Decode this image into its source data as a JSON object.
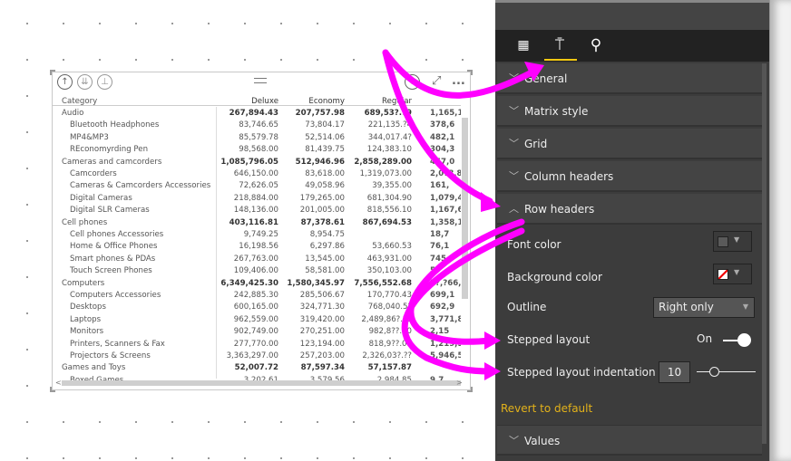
{
  "visual": {
    "toolbar": {
      "drill_up": "arrow-up-icon",
      "drill_down_all": "double-arrow-down-icon",
      "expand": "expand-hierarchy-icon",
      "drill_mode": "arrow-down-circle-icon",
      "focus": "focus-mode-icon",
      "more": "..."
    },
    "columns": [
      "Category",
      "Deluxe",
      "Economy",
      "Regular",
      ""
    ],
    "rows": [
      {
        "level": 0,
        "cat": "Audio",
        "v": [
          "267,894.43",
          "207,757.98",
          "689,53?.?9",
          "1,165,1"
        ]
      },
      {
        "level": 1,
        "cat": "Bluetooth Headphones",
        "v": [
          "83,746.65",
          "73,804.17",
          "221,135.?4",
          "378,6"
        ]
      },
      {
        "level": 1,
        "cat": "MP4&MP3",
        "v": [
          "85,579.78",
          "52,514.06",
          "344,017.4?",
          "482,1"
        ]
      },
      {
        "level": 1,
        "cat": "REconomyrding Pen",
        "v": [
          "98,568.00",
          "81,439.75",
          "124,383.10",
          "304,3"
        ]
      },
      {
        "level": 0,
        "cat": "Cameras and camcorders",
        "v": [
          "1,085,796.05",
          "512,946.96",
          "2,858,289.00",
          "457,0"
        ]
      },
      {
        "level": 1,
        "cat": "Camcorders",
        "v": [
          "646,150.00",
          "83,618.00",
          "1,319,073.00",
          "2,0?8,8"
        ]
      },
      {
        "level": 1,
        "cat": "Cameras & Camcorders Accessories",
        "v": [
          "72,626.05",
          "49,058.96",
          "39,355.00",
          "161,"
        ]
      },
      {
        "level": 1,
        "cat": "Digital Cameras",
        "v": [
          "218,884.00",
          "179,265.00",
          "681,304.90",
          "1,079,4"
        ]
      },
      {
        "level": 1,
        "cat": "Digital SLR Cameras",
        "v": [
          "148,136.00",
          "201,005.00",
          "818,556.10",
          "1,167,6"
        ]
      },
      {
        "level": 0,
        "cat": "Cell phones",
        "v": [
          "403,116.81",
          "87,378.61",
          "867,694.53",
          "1,358,1"
        ]
      },
      {
        "level": 1,
        "cat": "Cell phones Accessories",
        "v": [
          "9,749.25",
          "8,954.75",
          "",
          "18,7"
        ]
      },
      {
        "level": 1,
        "cat": "Home & Office Phones",
        "v": [
          "16,198.56",
          "6,297.86",
          "53,660.53",
          "76,1"
        ]
      },
      {
        "level": 1,
        "cat": "Smart phones & PDAs",
        "v": [
          "267,763.00",
          "13,545.00",
          "463,931.00",
          "745,"
        ]
      },
      {
        "level": 1,
        "cat": "Touch Screen Phones",
        "v": [
          "109,406.00",
          "58,581.00",
          "350,103.00",
          "5"
        ]
      },
      {
        "level": 0,
        "cat": "Computers",
        "v": [
          "6,349,425.30",
          "1,580,345.97",
          "7,556,552.68",
          "1?,?66,3"
        ]
      },
      {
        "level": 1,
        "cat": "Computers Accessories",
        "v": [
          "242,885.30",
          "285,506.67",
          "170,770.43",
          "699,1"
        ]
      },
      {
        "level": 1,
        "cat": "Desktops",
        "v": [
          "600,165.00",
          "324,771.30",
          "768,040.5?",
          "692,9"
        ]
      },
      {
        "level": 1,
        "cat": "Laptops",
        "v": [
          "962,559.00",
          "319,420.00",
          "2,489,86?.?5",
          "3,771,8"
        ]
      },
      {
        "level": 1,
        "cat": "Monitors",
        "v": [
          "902,749.00",
          "270,251.00",
          "982,8??.00",
          "2,15"
        ]
      },
      {
        "level": 1,
        "cat": "Printers, Scanners & Fax",
        "v": [
          "277,770.00",
          "123,194.00",
          "818,9??.00",
          "1,219,9"
        ]
      },
      {
        "level": 1,
        "cat": "Projectors & Screens",
        "v": [
          "3,363,297.00",
          "257,203.00",
          "2,326,03?.??",
          "5,946,5"
        ]
      },
      {
        "level": 0,
        "cat": "Games and Toys",
        "v": [
          "52,007.72",
          "87,597.34",
          "57,157.87",
          ""
        ]
      },
      {
        "level": 1,
        "cat": "Boxed Games",
        "v": [
          "3,202.61",
          "3,579.56",
          "2,984.85",
          "9,7"
        ]
      }
    ]
  },
  "panel": {
    "tabs": [
      {
        "name": "fields",
        "icon": "fields-grid-icon"
      },
      {
        "name": "format",
        "icon": "paint-roller-icon",
        "active": true
      },
      {
        "name": "analytics",
        "icon": "analytics-magnifier-icon"
      }
    ],
    "sections": [
      "General",
      "Matrix style",
      "Grid",
      "Column headers",
      "Row headers"
    ],
    "row_headers": {
      "font_color_label": "Font color",
      "font_color": "#5a5a5a",
      "background_color_label": "Background color",
      "outline_label": "Outline",
      "outline_value": "Right only",
      "stepped_layout_label": "Stepped layout",
      "stepped_layout_value": "On",
      "indentation_label": "Stepped layout indentation",
      "indentation_value": "10",
      "revert": "Revert to default"
    },
    "values_section": "Values"
  },
  "colors": {
    "accent": "#f2c811",
    "annotation": "#ff00ff",
    "revert": "#e3b21a"
  }
}
